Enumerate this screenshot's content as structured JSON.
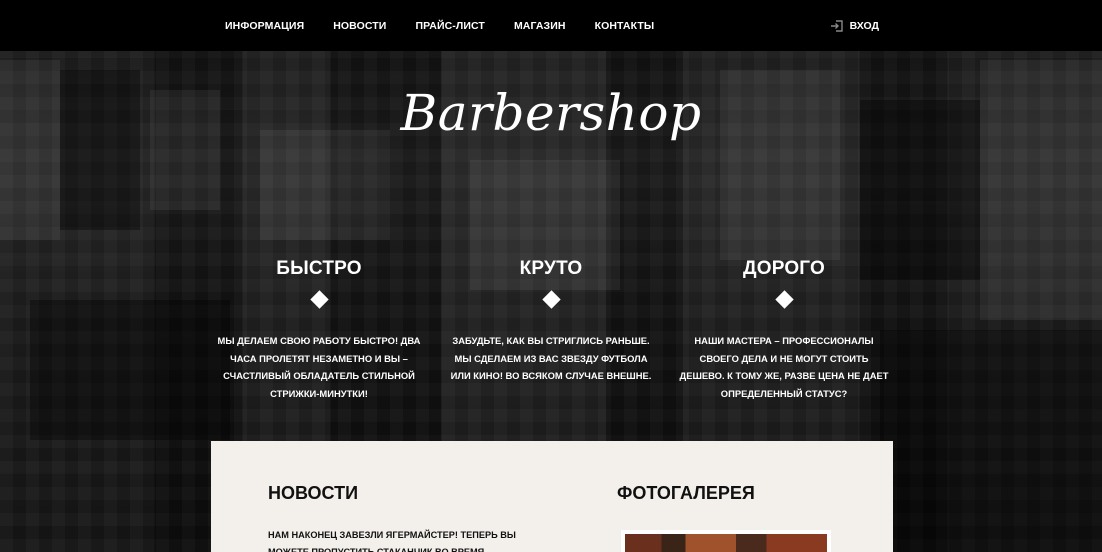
{
  "nav": {
    "items": [
      "ИНФОРМАЦИЯ",
      "НОВОСТИ",
      "ПРАЙС-ЛИСТ",
      "МАГАЗИН",
      "КОНТАКТЫ"
    ],
    "login_label": "ВХОД",
    "login_icon": "login-icon"
  },
  "hero": {
    "logo": "Barbershop"
  },
  "features": [
    {
      "title": "БЫСТРО",
      "text": "МЫ ДЕЛАЕМ СВОЮ РАБОТУ БЫСТРО! ДВА ЧАСА ПРОЛЕТЯТ НЕЗАМЕТНО И ВЫ – СЧАСТЛИВЫЙ ОБЛАДАТЕЛЬ СТИЛЬНОЙ СТРИЖКИ-МИНУТКИ!"
    },
    {
      "title": "КРУТО",
      "text": "ЗАБУДЬТЕ, КАК ВЫ СТРИГЛИСЬ РАНЬШЕ. МЫ СДЕЛАЕМ ИЗ ВАС ЗВЕЗДУ ФУТБОЛА ИЛИ КИНО! ВО ВСЯКОМ СЛУЧАЕ ВНЕШНЕ."
    },
    {
      "title": "ДОРОГО",
      "text": "НАШИ МАСТЕРА – ПРОФЕССИОНАЛЫ СВОЕГО ДЕЛА И НЕ МОГУТ СТОИТЬ ДЕШЕВО. К ТОМУ ЖЕ, РАЗВЕ ЦЕНА НЕ ДАЕТ ОПРЕДЕЛЕННЫЙ СТАТУС?"
    }
  ],
  "content": {
    "news_title": "НОВОСТИ",
    "news_text": "НАМ НАКОНЕЦ ЗАВЕЗЛИ ЯГЕРМАЙСТЕР! ТЕПЕРЬ ВЫ МОЖЕТЕ ПРОПУСТИТЬ СТАКАНЧИК ВО ВРЕМЯ СТРИЖКИ",
    "gallery_title": "ФОТОГАЛЕРЕЯ"
  },
  "colors": {
    "topbar": "#000000",
    "panel": "#f3f0eb",
    "text_light": "#ffffff",
    "text_dark": "#111111"
  }
}
